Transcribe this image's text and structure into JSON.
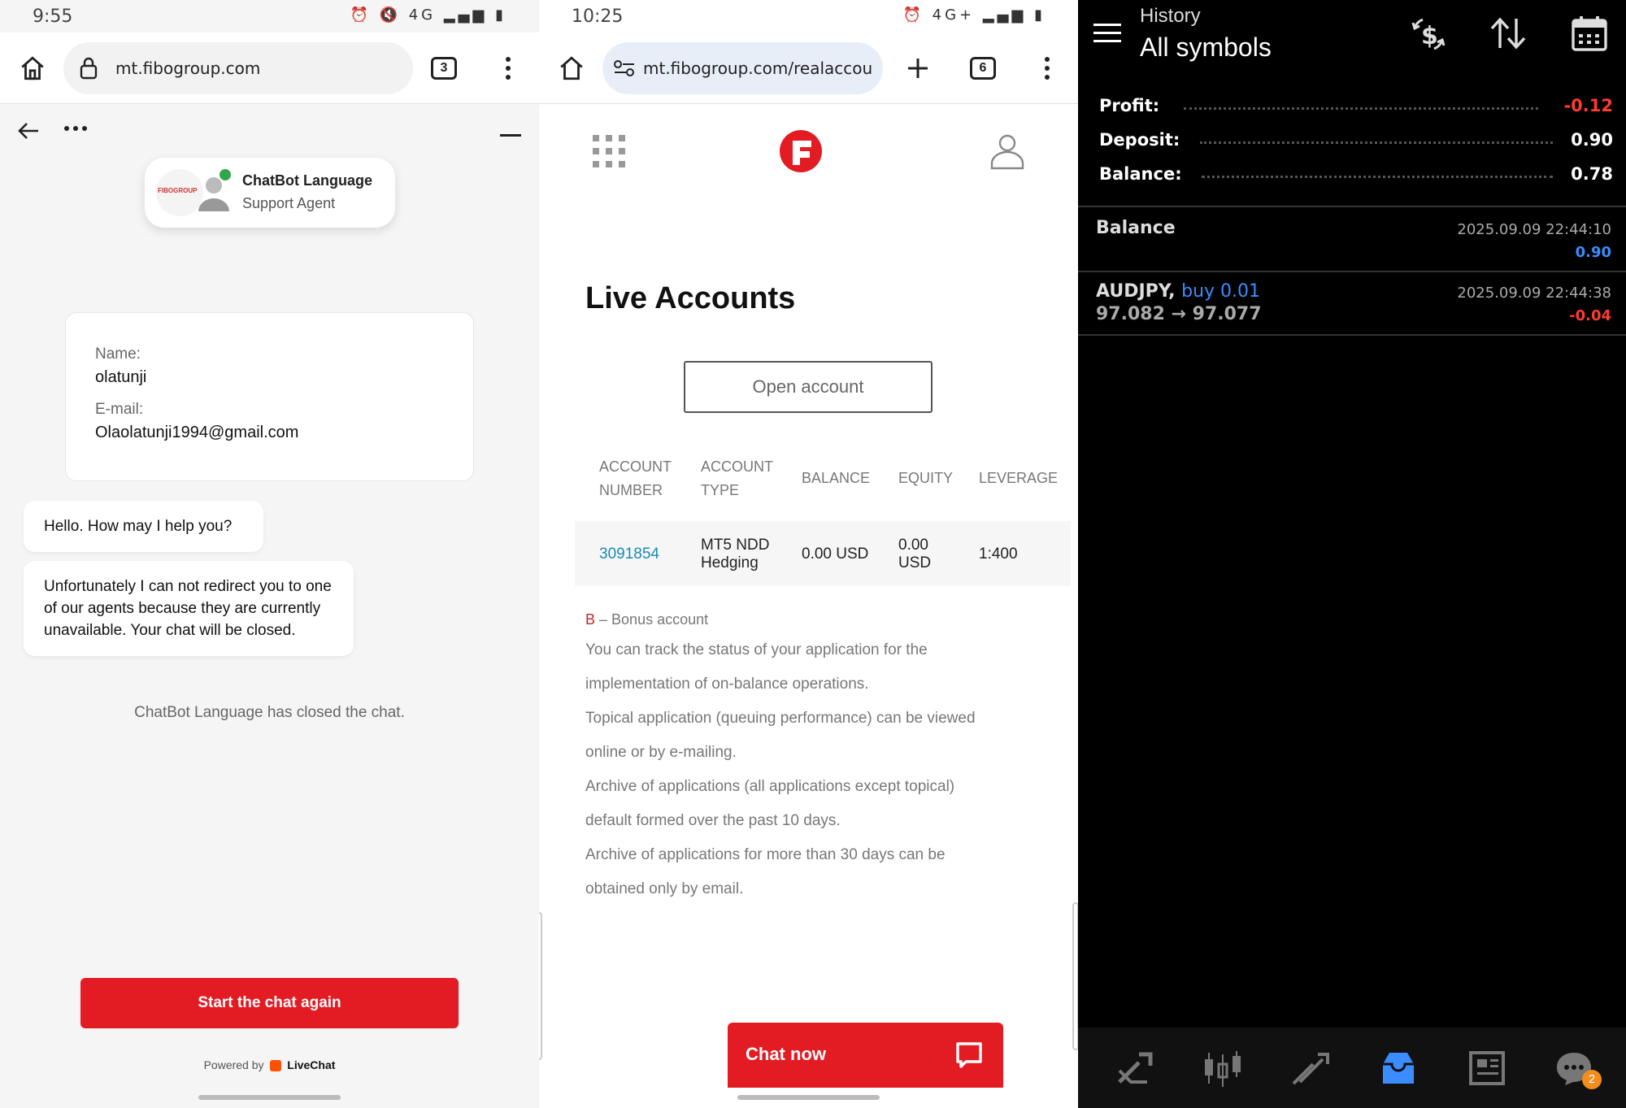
{
  "chat_screen": {
    "status_time": "9:55",
    "status_icons": "⏰ 🔇 4G ▂▄▆ ▮",
    "url": "mt.fibogroup.com",
    "tab_count": "3",
    "agent": {
      "name": "ChatBot Language",
      "role": "Support Agent",
      "logo_text": "FIBOGROUP"
    },
    "info": {
      "name_label": "Name:",
      "name_value": "olatunji",
      "email_label": "E-mail:",
      "email_value": "Olaolatunji1994@gmail.com"
    },
    "messages": [
      "Hello. How may I help you?",
      "Unfortunately I can not redirect you to one of our agents because they are currently unavailable. Your chat will be closed."
    ],
    "system_message": "ChatBot Language has closed the chat.",
    "restart_button": "Start the chat again",
    "powered_by": "Powered by",
    "powered_brand": "LiveChat"
  },
  "accounts_screen": {
    "status_time": "10:25",
    "status_icons": "⏰ 4G+ ▂▄▆ ▮",
    "url": "mt.fibogroup.com/realaccou",
    "tab_count": "6",
    "title": "Live Accounts",
    "open_account_button": "Open account",
    "table": {
      "headers": [
        "ACCOUNT NUMBER",
        "ACCOUNT TYPE",
        "BALANCE",
        "EQUITY",
        "LEVERAGE"
      ],
      "rows": [
        {
          "account_number": "3091854",
          "account_type": "MT5 NDD Hedging",
          "balance": "0.00 USD",
          "equity": "0.00 USD",
          "leverage": "1:400"
        }
      ]
    },
    "bonus_marker": "B",
    "bonus_text": "– Bonus account",
    "notes": [
      "You can track the status of your application for the",
      "implementation of on-balance operations.",
      "Topical application (queuing performance) can be viewed",
      "online or by e-mailing.",
      "Archive of applications (all applications except topical)",
      "default formed over the past 10 days.",
      "Archive of applications for more than 30 days can be",
      "obtained only by email."
    ],
    "chat_now_button": "Chat now"
  },
  "history_screen": {
    "header_title": "History",
    "header_subtitle": "All symbols",
    "summary": [
      {
        "label": "Profit:",
        "value": "-0.12",
        "color": "#ff3b30"
      },
      {
        "label": "Deposit:",
        "value": "0.90",
        "color": "#ffffff"
      },
      {
        "label": "Balance:",
        "value": "0.78",
        "color": "#ffffff"
      }
    ],
    "deals": [
      {
        "title": "Balance",
        "time": "2025.09.09 22:44:10",
        "value": "0.90",
        "value_color": "#3b8cff"
      },
      {
        "symbol": "AUDJPY,",
        "side": "buy 0.01",
        "prices": "97.082 → 97.077",
        "time": "2025.09.09 22:44:38",
        "value": "-0.04",
        "value_color": "#ff3b30"
      }
    ],
    "nav_badge": "2",
    "accent": "#3b8cff"
  }
}
